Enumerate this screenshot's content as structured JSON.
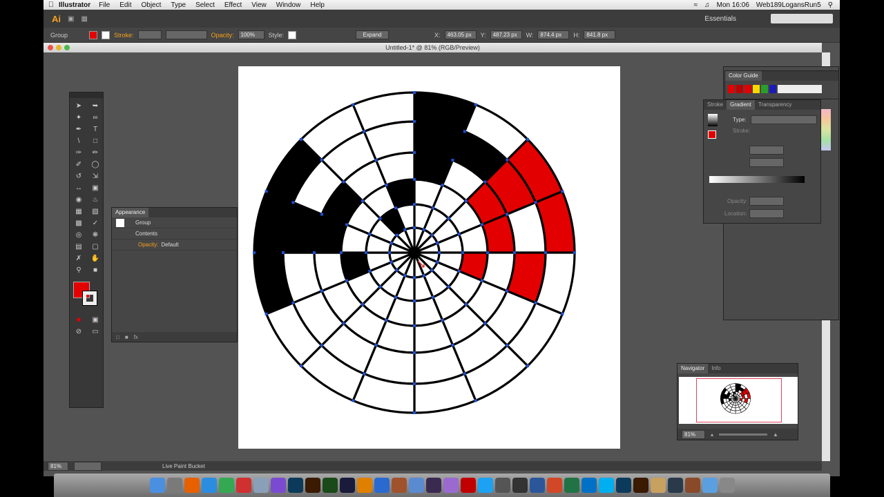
{
  "menubar": {
    "app_name": "Illustrator",
    "items": [
      "File",
      "Edit",
      "Object",
      "Type",
      "Select",
      "Effect",
      "View",
      "Window",
      "Help"
    ],
    "clock": "Mon 16:06",
    "user": "Web189LogansRun5"
  },
  "appbar": {
    "logo": "Ai",
    "workspace": "Essentials"
  },
  "control": {
    "selection_label": "Group",
    "stroke_label": "Stroke:",
    "opacity_label": "Opacity:",
    "opacity_value": "100%",
    "style_label": "Style:",
    "expand_label": "Expand",
    "x_label": "X:",
    "x_value": "463.05 px",
    "y_label": "Y:",
    "y_value": "487.23 px",
    "w_label": "W:",
    "w_value": "874.4 px",
    "h_label": "H:",
    "h_value": "841.8 px"
  },
  "document": {
    "title": "Untitled-1* @ 81% (RGB/Preview)"
  },
  "status": {
    "zoom": "81%",
    "tool": "Live Paint Bucket"
  },
  "appearance_panel": {
    "tab": "Appearance",
    "rows": [
      {
        "label": "Group",
        "value": ""
      },
      {
        "label": "Contents",
        "value": ""
      },
      {
        "label": "Opacity:",
        "value": "Default"
      }
    ]
  },
  "color_guide_panel": {
    "tab": "Color Guide",
    "harmony": [
      "#e30000",
      "#c00000",
      "#e30000",
      "#ffd700",
      "#2a9d2a",
      "#1c1cb4",
      "#eeeeee"
    ]
  },
  "gradient_panel": {
    "tabs": [
      "Stroke",
      "Gradient",
      "Transparency"
    ],
    "type_label": "Type:",
    "stroke_label": "Stroke:",
    "opacity_label": "Opacity:",
    "location_label": "Location:"
  },
  "navigator_panel": {
    "tabs": [
      "Navigator",
      "Info"
    ],
    "zoom": "81%"
  },
  "colors": {
    "fill": "#e30000",
    "black": "#000000",
    "white": "#ffffff",
    "selection": "#1f4fd0"
  },
  "dock_icons": [
    "finder",
    "system-prefs",
    "firefox",
    "safari",
    "chrome",
    "opera",
    "preview",
    "itunes",
    "photoshop",
    "illustrator",
    "dreamweaver",
    "after-effects",
    "vlc",
    "app-store",
    "guitar",
    "mail",
    "bridge",
    "flower",
    "flash",
    "twitter",
    "camera",
    "unity",
    "word",
    "powerpoint",
    "excel",
    "outlook",
    "skype",
    "photoshop-2",
    "illustrator-2",
    "photos",
    "lightroom",
    "guitar-2",
    "folder",
    "trash"
  ]
}
